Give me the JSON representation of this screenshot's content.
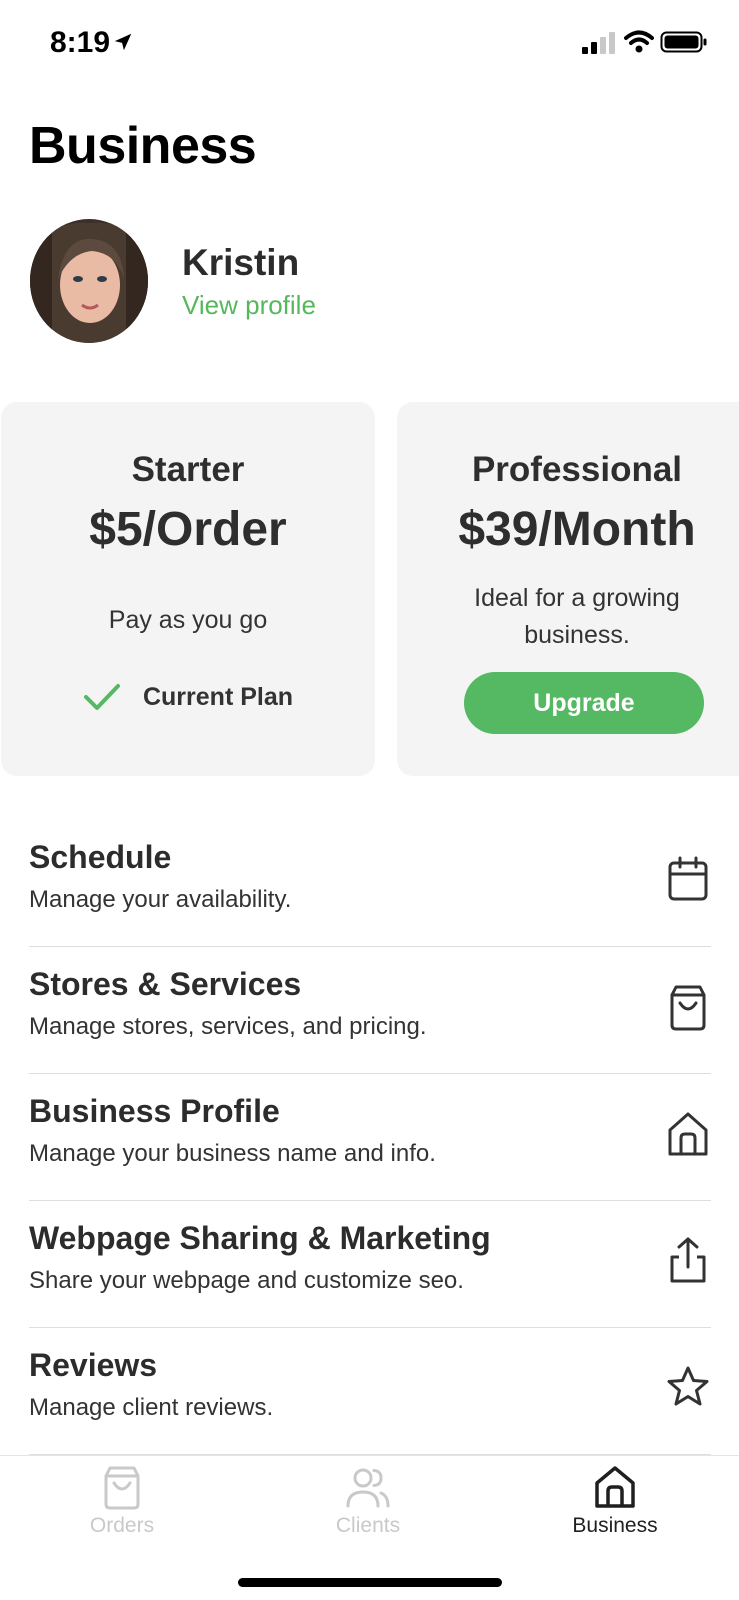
{
  "status_bar": {
    "time": "8:19"
  },
  "page": {
    "title": "Business"
  },
  "profile": {
    "name": "Kristin",
    "link": "View profile"
  },
  "plans": [
    {
      "name": "Starter",
      "price": "$5/Order",
      "description": "Pay as you go",
      "status": "Current Plan"
    },
    {
      "name": "Professional",
      "price": "$39/Month",
      "description": "Ideal for a growing business.",
      "action": "Upgrade"
    }
  ],
  "menu": [
    {
      "title": "Schedule",
      "subtitle": "Manage your availability.",
      "icon": "calendar-icon"
    },
    {
      "title": "Stores & Services",
      "subtitle": "Manage stores, services, and pricing.",
      "icon": "shopping-bag-icon"
    },
    {
      "title": "Business Profile",
      "subtitle": "Manage your business name and info.",
      "icon": "storefront-icon"
    },
    {
      "title": "Webpage Sharing & Marketing",
      "subtitle": "Share your webpage and customize seo.",
      "icon": "share-icon"
    },
    {
      "title": "Reviews",
      "subtitle": "Manage client reviews.",
      "icon": "star-icon"
    }
  ],
  "nav": [
    {
      "label": "Orders",
      "icon": "shopping-bag-icon",
      "active": false
    },
    {
      "label": "Clients",
      "icon": "users-icon",
      "active": false
    },
    {
      "label": "Business",
      "icon": "storefront-icon",
      "active": true
    }
  ],
  "colors": {
    "accent": "#55b862",
    "card_bg": "#f4f4f4",
    "inactive_tab": "#c9c9c9"
  }
}
